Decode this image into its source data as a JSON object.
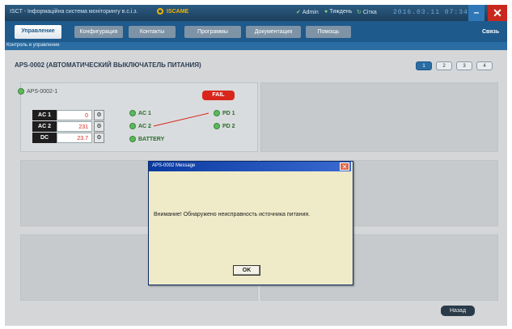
{
  "window": {
    "title": "ISCT - Інформаційна система моніторингу в.с.і.з.",
    "brand": "ISCAME",
    "items": [
      "Admin",
      "Тиждень",
      "Сітка"
    ],
    "clock": "2016.03.11 07:34:24",
    "minimize": "–",
    "close": "✕"
  },
  "tabs": [
    "Управление",
    "Конфигурация",
    "Контакты",
    "Программы",
    "Документация",
    "Помощь"
  ],
  "tab_link": "Связь",
  "breadcrumb": "Контроль и управление",
  "page": {
    "title": "APS-0002 (АВТОМАТИЧЕСКИЙ ВЫКЛЮЧАТЕЛЬ ПИТАНИЯ)",
    "pager": [
      "1",
      "2",
      "3",
      "4"
    ]
  },
  "device": {
    "name": "APS-0002-1",
    "status": "FAIL",
    "meters": [
      {
        "label": "AC 1",
        "value": "0"
      },
      {
        "label": "AC 2",
        "value": "231"
      },
      {
        "label": "DC",
        "value": "23.7"
      }
    ],
    "meter_btn": "⚙",
    "sources": [
      "AC 1",
      "AC 2",
      "BATTERY"
    ],
    "outputs": [
      "PD 1",
      "PD 2"
    ]
  },
  "dialog": {
    "title": "APS-0002 Message",
    "message": "Внимание! Обнаружено неисправность источника питания.",
    "ok": "OK",
    "close": "✕"
  },
  "back_button": "Назад",
  "colors": {
    "accent": "#1f5a8c",
    "fail": "#d9261c",
    "ok_led": "#5cb85c"
  }
}
